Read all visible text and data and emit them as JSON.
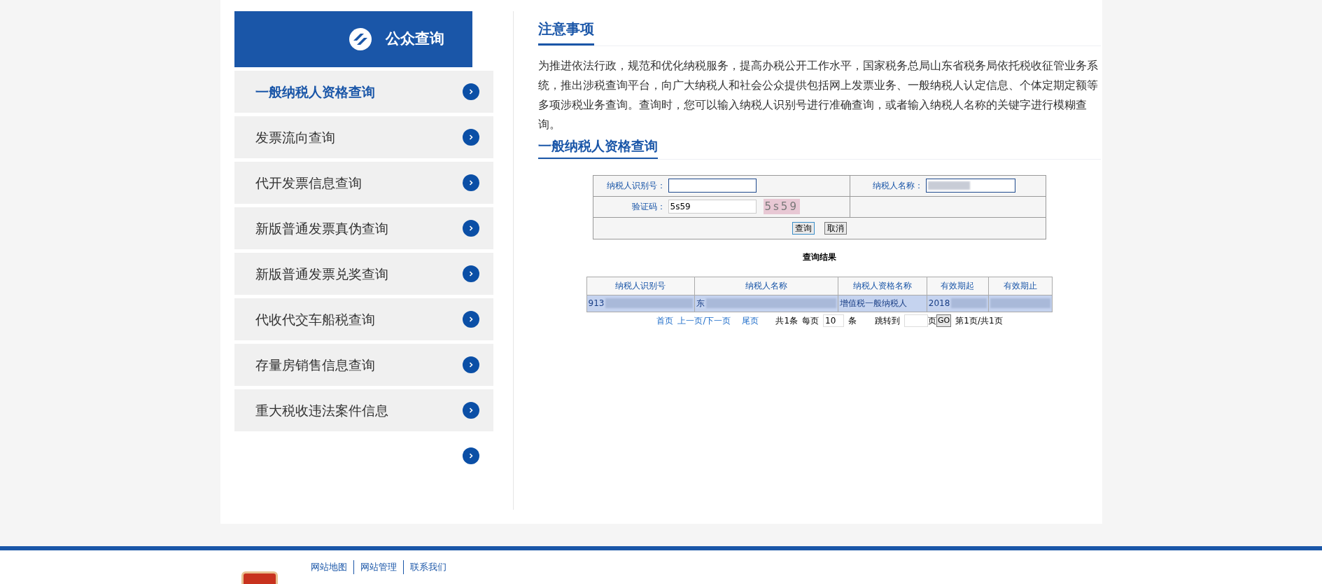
{
  "sidebar": {
    "title": "公众查询",
    "items": [
      {
        "label": "一般纳税人资格查询",
        "selected": true
      },
      {
        "label": "发票流向查询",
        "selected": false
      },
      {
        "label": "代开发票信息查询",
        "selected": false
      },
      {
        "label": "新版普通发票真伪查询",
        "selected": false
      },
      {
        "label": "新版普通发票兑奖查询",
        "selected": false
      },
      {
        "label": "代收代交车船税查询",
        "selected": false
      },
      {
        "label": "存量房销售信息查询",
        "selected": false
      },
      {
        "label": "重大税收违法案件信息",
        "selected": false
      }
    ]
  },
  "notice": {
    "title": "注意事项",
    "text": "为推进依法行政，规范和优化纳税服务，提高办税公开工作水平，国家税务总局山东省税务局依托税收征管业务系统，推出涉税查询平台，向广大纳税人和社会公众提供包括网上发票业务、一般纳税人认定信息、个体定期定额等多项涉税业务查询。查询时，您可以输入纳税人识别号进行准确查询，或者输入纳税人名称的关键字进行模糊查询。"
  },
  "section_title": "一般纳税人资格查询",
  "form": {
    "taxpayer_id_label": "纳税人识别号：",
    "taxpayer_name_label": "纳税人名称：",
    "captcha_label": "验证码：",
    "captcha_value": "5s59",
    "captcha_image": "5s59",
    "buttons": [
      "查询",
      "取消"
    ]
  },
  "results": {
    "title": "查询结果",
    "columns": [
      "纳税人识别号",
      "纳税人名称",
      "纳税人资格名称",
      "有效期起",
      "有效期止"
    ],
    "rows": [
      [
        "913",
        "东",
        "增值税一般纳税人",
        "2018"
      ]
    ]
  },
  "pagination": {
    "links": [
      "首页",
      "上一页/下一页",
      "尾页"
    ],
    "total": "共1条",
    "per_page_label": "每页",
    "per_page": "10",
    "per_page_unit": "条",
    "jump_label": "跳转到",
    "jump_unit": "页",
    "go_button": "GO",
    "page_info": "第1页/共1页"
  },
  "footer": {
    "links": [
      "网站地图",
      "网站管理",
      "联系我们"
    ]
  }
}
